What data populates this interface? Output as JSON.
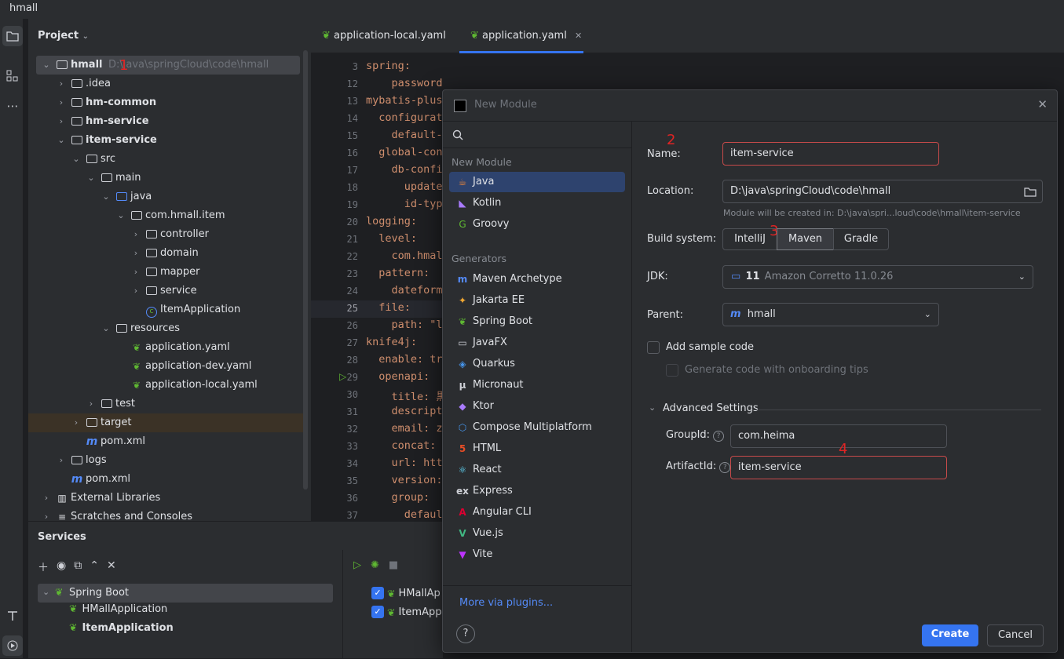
{
  "window": {
    "title": "hmall"
  },
  "project": {
    "header": "Project",
    "tree": [
      {
        "label": "hmall",
        "path": "D:\\java\\springCloud\\code\\hmall",
        "bold": true
      },
      {
        "label": ".idea"
      },
      {
        "label": "hm-common",
        "bold": true
      },
      {
        "label": "hm-service",
        "bold": true
      },
      {
        "label": "item-service",
        "bold": true
      },
      {
        "label": "src"
      },
      {
        "label": "main"
      },
      {
        "label": "java"
      },
      {
        "label": "com.hmall.item"
      },
      {
        "label": "controller"
      },
      {
        "label": "domain"
      },
      {
        "label": "mapper"
      },
      {
        "label": "service"
      },
      {
        "label": "ItemApplication"
      },
      {
        "label": "resources"
      },
      {
        "label": "application.yaml"
      },
      {
        "label": "application-dev.yaml"
      },
      {
        "label": "application-local.yaml"
      },
      {
        "label": "test"
      },
      {
        "label": "target"
      },
      {
        "label": "pom.xml"
      },
      {
        "label": "logs"
      },
      {
        "label": "pom.xml"
      },
      {
        "label": "External Libraries"
      },
      {
        "label": "Scratches and Consoles"
      }
    ]
  },
  "services": {
    "header": "Services",
    "tree": [
      {
        "label": "Spring Boot"
      },
      {
        "label": "HMallApplication"
      },
      {
        "label": "ItemApplication",
        "bold": true
      }
    ],
    "right_items": [
      "HMallAp",
      "ItemApp"
    ]
  },
  "editor": {
    "tabs": [
      {
        "label": "application-local.yaml"
      },
      {
        "label": "application.yaml",
        "active": true
      }
    ],
    "lines": [
      {
        "n": "3",
        "text": "spring:"
      },
      {
        "n": "12",
        "text": "    password: ${hm.db.pw}"
      },
      {
        "n": "13",
        "text": "mybatis-plus"
      },
      {
        "n": "14",
        "text": "  configurati"
      },
      {
        "n": "15",
        "text": "    default-"
      },
      {
        "n": "16",
        "text": "  global-con"
      },
      {
        "n": "17",
        "text": "    db-confi"
      },
      {
        "n": "18",
        "text": "      update"
      },
      {
        "n": "19",
        "text": "      id-type"
      },
      {
        "n": "20",
        "text": "logging:"
      },
      {
        "n": "21",
        "text": "  level:"
      },
      {
        "n": "22",
        "text": "    com.hmal"
      },
      {
        "n": "23",
        "text": "  pattern:"
      },
      {
        "n": "24",
        "text": "    dateform"
      },
      {
        "n": "25",
        "text": "  file:"
      },
      {
        "n": "26",
        "text": "    path: \"l"
      },
      {
        "n": "27",
        "text": "knife4j:"
      },
      {
        "n": "28",
        "text": "  enable: tr"
      },
      {
        "n": "29",
        "text": "  openapi:"
      },
      {
        "n": "30",
        "text": "    title: 黒"
      },
      {
        "n": "31",
        "text": "    descript"
      },
      {
        "n": "32",
        "text": "    email: z"
      },
      {
        "n": "33",
        "text": "    concat: "
      },
      {
        "n": "34",
        "text": "    url: http"
      },
      {
        "n": "35",
        "text": "    version:"
      },
      {
        "n": "36",
        "text": "    group:"
      },
      {
        "n": "37",
        "text": "      defaul"
      }
    ]
  },
  "dialog": {
    "title": "New Module",
    "new_module_section": "New Module",
    "languages": [
      "Java",
      "Kotlin",
      "Groovy"
    ],
    "generators_section": "Generators",
    "generators": [
      "Maven Archetype",
      "Jakarta EE",
      "Spring Boot",
      "JavaFX",
      "Quarkus",
      "Micronaut",
      "Ktor",
      "Compose Multiplatform",
      "HTML",
      "React",
      "Express",
      "Angular CLI",
      "Vue.js",
      "Vite"
    ],
    "more_plugins": "More via plugins...",
    "help_label": "?",
    "name_label": "Name:",
    "name_value": "item-service",
    "location_label": "Location:",
    "location_value": "D:\\java\\springCloud\\code\\hmall",
    "location_hint": "Module will be created in: D:\\java\\spri...loud\\code\\hmall\\item-service",
    "build_label": "Build system:",
    "build_options": [
      "IntelliJ",
      "Maven",
      "Gradle"
    ],
    "jdk_label": "JDK:",
    "jdk_version": "11",
    "jdk_value": "Amazon Corretto 11.0.26",
    "parent_label": "Parent:",
    "parent_value": "hmall",
    "sample_code": "Add sample code",
    "onboarding": "Generate code with onboarding tips",
    "advanced": "Advanced Settings",
    "groupid_label": "GroupId:",
    "groupid_value": "com.heima",
    "artifactid_label": "ArtifactId:",
    "artifactid_value": "item-service",
    "create": "Create",
    "cancel": "Cancel",
    "annotations": [
      "1",
      "2",
      "3",
      "4"
    ]
  },
  "colors": {
    "accent": "#3574f0",
    "selection": "#2e436e",
    "error": "#c74a4a",
    "spring": "#5fb832"
  }
}
